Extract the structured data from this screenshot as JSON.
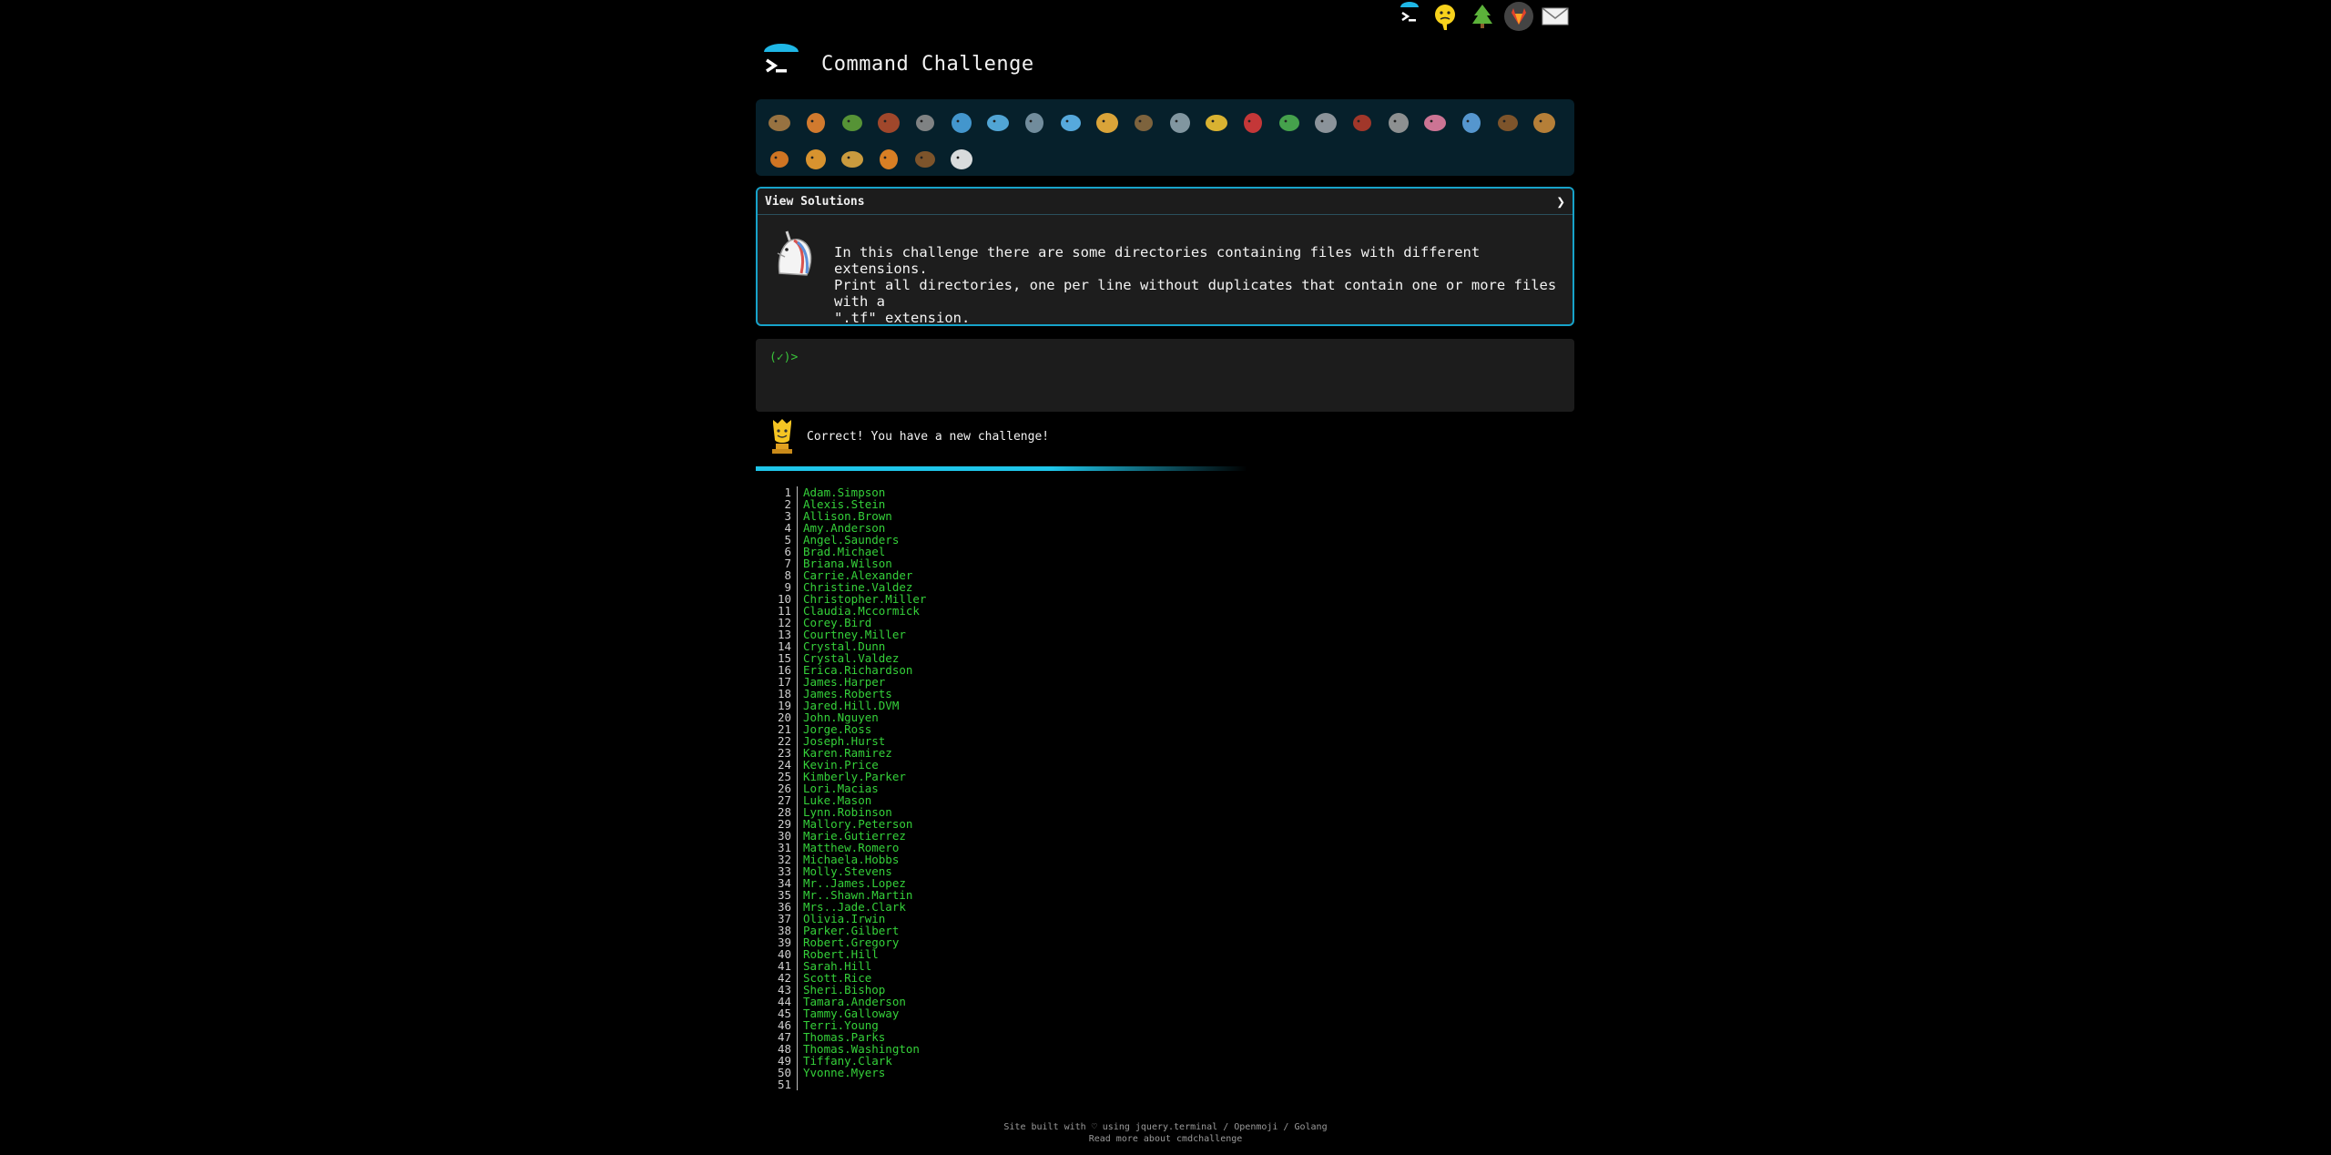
{
  "header": {
    "title": "Command Challenge"
  },
  "top_icons": [
    {
      "name": "cmd-challenge-icon"
    },
    {
      "name": "hint-face-icon"
    },
    {
      "name": "tree-icon"
    },
    {
      "name": "gitlab-icon"
    },
    {
      "name": "mail-icon"
    }
  ],
  "badges": [
    {
      "name": "snail-badge",
      "color": "#a77b44"
    },
    {
      "name": "butterfly-badge",
      "color": "#e8842f"
    },
    {
      "name": "snake-badge",
      "color": "#5fa037"
    },
    {
      "name": "match-badge",
      "color": "#b14b2b"
    },
    {
      "name": "gear-badge",
      "color": "#8d8d8d"
    },
    {
      "name": "whale-badge",
      "color": "#4aa3df"
    },
    {
      "name": "dolphin-badge",
      "color": "#5ab4e8"
    },
    {
      "name": "shark-badge",
      "color": "#7d98a8"
    },
    {
      "name": "fish-badge",
      "color": "#5fb8f0"
    },
    {
      "name": "tropical-fish-badge",
      "color": "#f2b33b"
    },
    {
      "name": "turtle-shell-badge",
      "color": "#8b6a3f"
    },
    {
      "name": "wolf-badge",
      "color": "#8fa3ad"
    },
    {
      "name": "bee-badge",
      "color": "#f1c232"
    },
    {
      "name": "ladybug-badge",
      "color": "#d93a3a"
    },
    {
      "name": "caterpillar-badge",
      "color": "#4caf50"
    },
    {
      "name": "pin-badge",
      "color": "#9aa0a6"
    },
    {
      "name": "ant-badge",
      "color": "#b33a2a"
    },
    {
      "name": "moth-badge",
      "color": "#9c9c9c"
    },
    {
      "name": "worm-badge",
      "color": "#e27da0"
    },
    {
      "name": "microbe-badge",
      "color": "#5ea3e0"
    },
    {
      "name": "monkey-badge",
      "color": "#8b5a2b"
    },
    {
      "name": "dog-badge",
      "color": "#c98a3a"
    },
    {
      "name": "fox-badge",
      "color": "#e67e22"
    },
    {
      "name": "cat-badge",
      "color": "#f0a030"
    },
    {
      "name": "lion-badge",
      "color": "#e0a840"
    },
    {
      "name": "tiger-badge",
      "color": "#f08a24"
    },
    {
      "name": "horse-badge",
      "color": "#8b5a2b"
    },
    {
      "name": "unicorn-badge",
      "color": "#f0f0f0"
    }
  ],
  "challenge": {
    "view_solutions": "View Solutions",
    "chevron": "❯",
    "description": "In this challenge there are some directories containing files with different extensions.\nPrint all directories, one per line without duplicates that contain one or more files with a\n\".tf\" extension."
  },
  "terminal": {
    "prompt": "(✓)>"
  },
  "success": {
    "message": "Correct! You have a new challenge!"
  },
  "output_lines": [
    {
      "n": "1",
      "text": "Adam.Simpson"
    },
    {
      "n": "2",
      "text": "Alexis.Stein"
    },
    {
      "n": "3",
      "text": "Allison.Brown"
    },
    {
      "n": "4",
      "text": "Amy.Anderson"
    },
    {
      "n": "5",
      "text": "Angel.Saunders"
    },
    {
      "n": "6",
      "text": "Brad.Michael"
    },
    {
      "n": "7",
      "text": "Briana.Wilson"
    },
    {
      "n": "8",
      "text": "Carrie.Alexander"
    },
    {
      "n": "9",
      "text": "Christine.Valdez"
    },
    {
      "n": "10",
      "text": "Christopher.Miller"
    },
    {
      "n": "11",
      "text": "Claudia.Mccormick"
    },
    {
      "n": "12",
      "text": "Corey.Bird"
    },
    {
      "n": "13",
      "text": "Courtney.Miller"
    },
    {
      "n": "14",
      "text": "Crystal.Dunn"
    },
    {
      "n": "15",
      "text": "Crystal.Valdez"
    },
    {
      "n": "16",
      "text": "Erica.Richardson"
    },
    {
      "n": "17",
      "text": "James.Harper"
    },
    {
      "n": "18",
      "text": "James.Roberts"
    },
    {
      "n": "19",
      "text": "Jared.Hill.DVM"
    },
    {
      "n": "20",
      "text": "John.Nguyen"
    },
    {
      "n": "21",
      "text": "Jorge.Ross"
    },
    {
      "n": "22",
      "text": "Joseph.Hurst"
    },
    {
      "n": "23",
      "text": "Karen.Ramirez"
    },
    {
      "n": "24",
      "text": "Kevin.Price"
    },
    {
      "n": "25",
      "text": "Kimberly.Parker"
    },
    {
      "n": "26",
      "text": "Lori.Macias"
    },
    {
      "n": "27",
      "text": "Luke.Mason"
    },
    {
      "n": "28",
      "text": "Lynn.Robinson"
    },
    {
      "n": "29",
      "text": "Mallory.Peterson"
    },
    {
      "n": "30",
      "text": "Marie.Gutierrez"
    },
    {
      "n": "31",
      "text": "Matthew.Romero"
    },
    {
      "n": "32",
      "text": "Michaela.Hobbs"
    },
    {
      "n": "33",
      "text": "Molly.Stevens"
    },
    {
      "n": "34",
      "text": "Mr..James.Lopez"
    },
    {
      "n": "35",
      "text": "Mr..Shawn.Martin"
    },
    {
      "n": "36",
      "text": "Mrs..Jade.Clark"
    },
    {
      "n": "37",
      "text": "Olivia.Irwin"
    },
    {
      "n": "38",
      "text": "Parker.Gilbert"
    },
    {
      "n": "39",
      "text": "Robert.Gregory"
    },
    {
      "n": "40",
      "text": "Robert.Hill"
    },
    {
      "n": "41",
      "text": "Sarah.Hill"
    },
    {
      "n": "42",
      "text": "Scott.Rice"
    },
    {
      "n": "43",
      "text": "Sheri.Bishop"
    },
    {
      "n": "44",
      "text": "Tamara.Anderson"
    },
    {
      "n": "45",
      "text": "Tammy.Galloway"
    },
    {
      "n": "46",
      "text": "Terri.Young"
    },
    {
      "n": "47",
      "text": "Thomas.Parks"
    },
    {
      "n": "48",
      "text": "Thomas.Washington"
    },
    {
      "n": "49",
      "text": "Tiffany.Clark"
    },
    {
      "n": "50",
      "text": "Yvonne.Myers"
    },
    {
      "n": "51",
      "text": ""
    }
  ],
  "footer": {
    "line1": "Site built with ♡ using jquery.terminal / Openmoji / Golang",
    "line2": "Read more about cmdchallenge"
  }
}
